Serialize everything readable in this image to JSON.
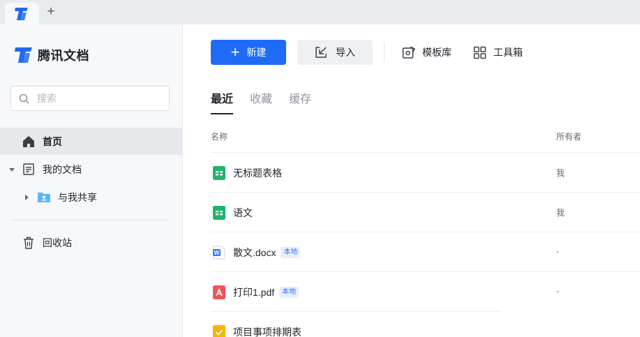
{
  "tabstrip": {
    "add_label": "+"
  },
  "sidebar": {
    "brand_name": "腾讯文档",
    "search_placeholder": "搜索",
    "nav": {
      "home": "首页",
      "my_docs": "我的文档",
      "shared": "与我共享",
      "trash": "回收站"
    }
  },
  "toolbar": {
    "new_label": "新建",
    "import_label": "导入",
    "template_label": "模板库",
    "toolbox_label": "工具箱"
  },
  "tabs": [
    "最近",
    "收藏",
    "缓存"
  ],
  "columns": {
    "name": "名称",
    "owner": "所有者"
  },
  "files": [
    {
      "name": "无标题表格",
      "owner": "我",
      "badge": "",
      "icon": "sheet-icon"
    },
    {
      "name": "语文",
      "owner": "我",
      "badge": "",
      "icon": "sheet-icon"
    },
    {
      "name": "散文.docx",
      "owner": "-",
      "badge": "本地",
      "icon": "word-icon"
    },
    {
      "name": "打印1.pdf",
      "owner": "-",
      "badge": "本地",
      "icon": "pdf-icon"
    },
    {
      "name": "项目事项排期表",
      "owner": "",
      "badge": "",
      "icon": "task-icon"
    }
  ],
  "colors": {
    "primary": "#1f6bf5",
    "sheet": "#21b36b",
    "word": "#3b7bf5",
    "pdf": "#f0555b",
    "task": "#f7b500",
    "folder": "#5cb8f5"
  }
}
